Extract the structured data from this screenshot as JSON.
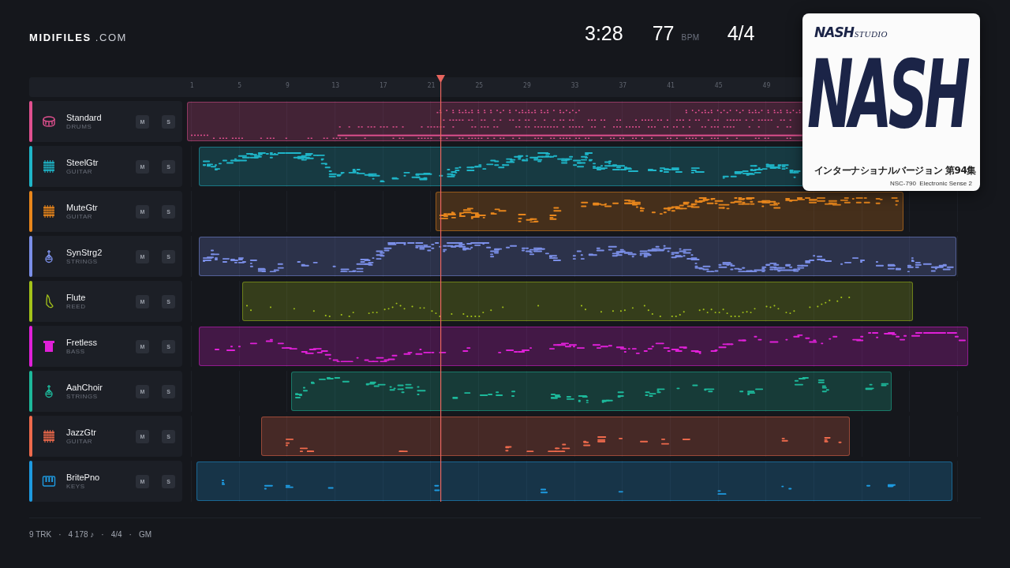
{
  "brand": {
    "name": "MIDIFILES",
    "suffix": ".COM"
  },
  "stats": {
    "time": "3:28",
    "tempo": "77",
    "tempo_unit": "BPM",
    "meter": "4/4"
  },
  "ruler": {
    "ticks": [
      "1",
      "5",
      "9",
      "13",
      "17",
      "21",
      "25",
      "29",
      "33",
      "37",
      "41",
      "45",
      "49"
    ]
  },
  "tracks": [
    {
      "name": "Standard",
      "category": "DRUMS",
      "kind": "drums",
      "color": "#e0508f",
      "muted": false,
      "soloed": false,
      "mute_label": "M",
      "solo_label": "S"
    },
    {
      "name": "SteelGtr",
      "category": "GUITAR",
      "kind": "guitar",
      "color": "#1fb5c8",
      "muted": false,
      "soloed": false,
      "mute_label": "M",
      "solo_label": "S"
    },
    {
      "name": "MuteGtr",
      "category": "GUITAR",
      "kind": "guitar",
      "color": "#e8861c",
      "muted": false,
      "soloed": false,
      "mute_label": "M",
      "solo_label": "S"
    },
    {
      "name": "SynStrg2",
      "category": "STRINGS",
      "kind": "strings",
      "color": "#7b8fe8",
      "muted": false,
      "soloed": false,
      "mute_label": "M",
      "solo_label": "S"
    },
    {
      "name": "Flute",
      "category": "REED",
      "kind": "reed",
      "color": "#a3c21a",
      "muted": false,
      "soloed": false,
      "mute_label": "M",
      "solo_label": "S"
    },
    {
      "name": "Fretless",
      "category": "BASS",
      "kind": "bass",
      "color": "#e020d8",
      "muted": false,
      "soloed": false,
      "mute_label": "M",
      "solo_label": "S"
    },
    {
      "name": "AahChoir",
      "category": "STRINGS",
      "kind": "strings",
      "color": "#1db89a",
      "muted": false,
      "soloed": false,
      "mute_label": "M",
      "solo_label": "S"
    },
    {
      "name": "JazzGtr",
      "category": "GUITAR",
      "kind": "guitar",
      "color": "#ee6a4c",
      "muted": false,
      "soloed": false,
      "mute_label": "M",
      "solo_label": "S"
    },
    {
      "name": "BritePno",
      "category": "KEYS",
      "kind": "keys",
      "color": "#1e9ae0",
      "muted": false,
      "soloed": false,
      "mute_label": "M",
      "solo_label": "S"
    }
  ],
  "cover": {
    "logo": "NASH",
    "logo_suffix": "STUDIO",
    "title": "NASH",
    "subtitle": "インターナショナルバージョン 第94集",
    "catalog": "NSC-790  Electronic Sense 2"
  },
  "footer": [
    "9 TRK",
    "·",
    "4 178 ♪",
    "·",
    "4/4",
    "·",
    "GM"
  ]
}
